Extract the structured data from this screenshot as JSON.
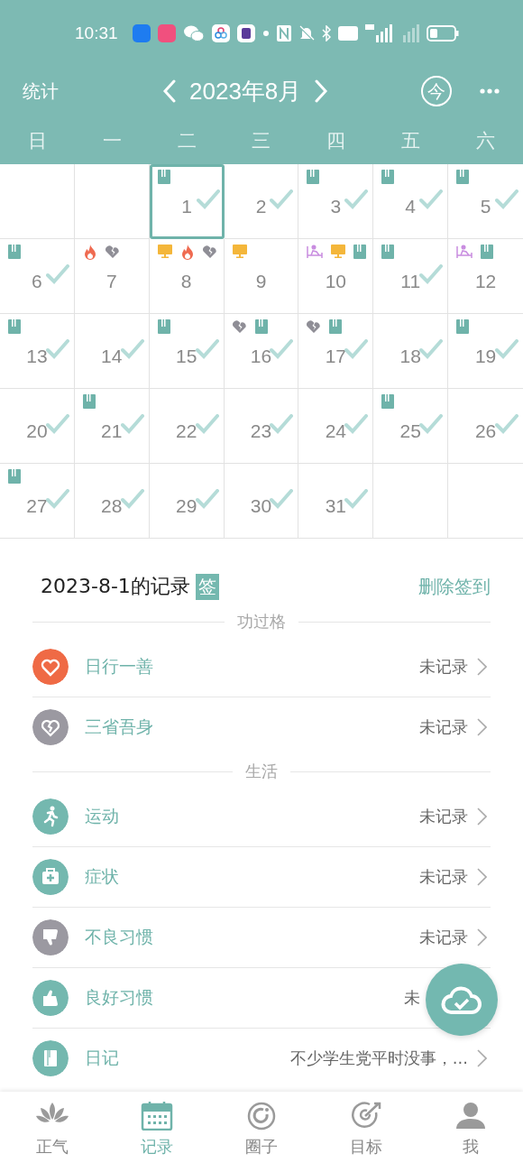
{
  "status_bar": {
    "time": "10:31"
  },
  "header": {
    "left": "统计",
    "month": "2023年8月",
    "today": "今"
  },
  "weekdays": [
    "日",
    "一",
    "二",
    "三",
    "四",
    "五",
    "六"
  ],
  "calendar": {
    "cells": [
      {
        "kind": "blank"
      },
      {
        "kind": "blank"
      },
      {
        "kind": "day",
        "day": "1",
        "selected": true,
        "checked": true,
        "marks": [
          {
            "kind": "book"
          }
        ]
      },
      {
        "kind": "day",
        "day": "2",
        "selected": false,
        "checked": true
      },
      {
        "kind": "day",
        "day": "3",
        "selected": false,
        "checked": true,
        "marks": [
          {
            "kind": "book"
          }
        ]
      },
      {
        "kind": "day",
        "day": "4",
        "selected": false,
        "checked": true,
        "marks": [
          {
            "kind": "book"
          }
        ]
      },
      {
        "kind": "day",
        "day": "5",
        "selected": false,
        "checked": true,
        "marks": [
          {
            "kind": "book"
          }
        ]
      },
      {
        "kind": "day",
        "day": "6",
        "selected": false,
        "checked": true,
        "marks": [
          {
            "kind": "book"
          }
        ]
      },
      {
        "kind": "day",
        "day": "7",
        "selected": false,
        "checked": false,
        "marks": [
          {
            "kind": "fire"
          },
          {
            "kind": "broken-heart"
          }
        ]
      },
      {
        "kind": "day",
        "day": "8",
        "selected": false,
        "checked": false,
        "marks": [
          {
            "kind": "monitor"
          },
          {
            "kind": "fire"
          },
          {
            "kind": "broken-heart"
          }
        ]
      },
      {
        "kind": "day",
        "day": "9",
        "selected": false,
        "checked": false,
        "marks": [
          {
            "kind": "monitor"
          }
        ]
      },
      {
        "kind": "day",
        "day": "10",
        "selected": false,
        "checked": false,
        "marks": [
          {
            "kind": "bed"
          },
          {
            "kind": "monitor"
          },
          {
            "kind": "book"
          }
        ]
      },
      {
        "kind": "day",
        "day": "11",
        "selected": false,
        "checked": true,
        "marks": [
          {
            "kind": "book"
          }
        ]
      },
      {
        "kind": "day",
        "day": "12",
        "selected": false,
        "checked": false,
        "marks": [
          {
            "kind": "bed"
          },
          {
            "kind": "book"
          }
        ]
      },
      {
        "kind": "day",
        "day": "13",
        "selected": false,
        "checked": true,
        "marks": [
          {
            "kind": "book"
          }
        ]
      },
      {
        "kind": "day",
        "day": "14",
        "selected": false,
        "checked": true
      },
      {
        "kind": "day",
        "day": "15",
        "selected": false,
        "checked": true,
        "marks": [
          {
            "kind": "book"
          }
        ]
      },
      {
        "kind": "day",
        "day": "16",
        "selected": false,
        "checked": true,
        "marks": [
          {
            "kind": "broken-heart"
          },
          {
            "kind": "book"
          }
        ]
      },
      {
        "kind": "day",
        "day": "17",
        "selected": false,
        "checked": true,
        "marks": [
          {
            "kind": "broken-heart"
          },
          {
            "kind": "book"
          }
        ]
      },
      {
        "kind": "day",
        "day": "18",
        "selected": false,
        "checked": true
      },
      {
        "kind": "day",
        "day": "19",
        "selected": false,
        "checked": true,
        "marks": [
          {
            "kind": "book"
          }
        ]
      },
      {
        "kind": "day",
        "day": "20",
        "selected": false,
        "checked": true
      },
      {
        "kind": "day",
        "day": "21",
        "selected": false,
        "checked": true,
        "marks": [
          {
            "kind": "book"
          }
        ]
      },
      {
        "kind": "day",
        "day": "22",
        "selected": false,
        "checked": true
      },
      {
        "kind": "day",
        "day": "23",
        "selected": false,
        "checked": true
      },
      {
        "kind": "day",
        "day": "24",
        "selected": false,
        "checked": true
      },
      {
        "kind": "day",
        "day": "25",
        "selected": false,
        "checked": true,
        "marks": [
          {
            "kind": "book"
          }
        ]
      },
      {
        "kind": "day",
        "day": "26",
        "selected": false,
        "checked": true
      },
      {
        "kind": "day",
        "day": "27",
        "selected": false,
        "checked": true,
        "marks": [
          {
            "kind": "book"
          }
        ]
      },
      {
        "kind": "day",
        "day": "28",
        "selected": false,
        "checked": true
      },
      {
        "kind": "day",
        "day": "29",
        "selected": false,
        "checked": true
      },
      {
        "kind": "day",
        "day": "30",
        "selected": false,
        "checked": true
      },
      {
        "kind": "day",
        "day": "31",
        "selected": false,
        "checked": true
      },
      {
        "kind": "blank"
      },
      {
        "kind": "blank"
      }
    ]
  },
  "record": {
    "title": "2023-8-1的记录",
    "badge": "签",
    "action": "删除签到",
    "sections": [
      {
        "heading": "功过格",
        "items": [
          {
            "kind": "heart",
            "color": "#ef6a45",
            "label": "日行一善",
            "value": "未记录",
            "chevron": true
          },
          {
            "kind": "broken-heart",
            "color": "#9b99a1",
            "label": "三省吾身",
            "value": "未记录",
            "chevron": true
          }
        ]
      },
      {
        "heading": "生活",
        "items": [
          {
            "kind": "running",
            "color": "#74b8af",
            "label": "运动",
            "value": "未记录",
            "chevron": true
          },
          {
            "kind": "medical",
            "color": "#74b8af",
            "label": "症状",
            "value": "未记录",
            "chevron": true
          },
          {
            "kind": "thumbs-down",
            "color": "#9b99a1",
            "label": "不良习惯",
            "value": "未记录",
            "chevron": true
          },
          {
            "kind": "thumbs-up",
            "color": "#74b8af",
            "label": "良好习惯",
            "value": "未",
            "chevron": false
          },
          {
            "kind": "book",
            "color": "#74b8af",
            "label": "日记",
            "value": "不少学生党平时没事，...",
            "chevron": true
          }
        ]
      }
    ]
  },
  "tabs": [
    {
      "kind": "lotus",
      "label": "正气",
      "selected": false
    },
    {
      "kind": "calendar",
      "label": "记录",
      "selected": true
    },
    {
      "kind": "circle",
      "label": "圈子",
      "selected": false
    },
    {
      "kind": "target",
      "label": "目标",
      "selected": false
    },
    {
      "kind": "person",
      "label": "我",
      "selected": false
    }
  ]
}
